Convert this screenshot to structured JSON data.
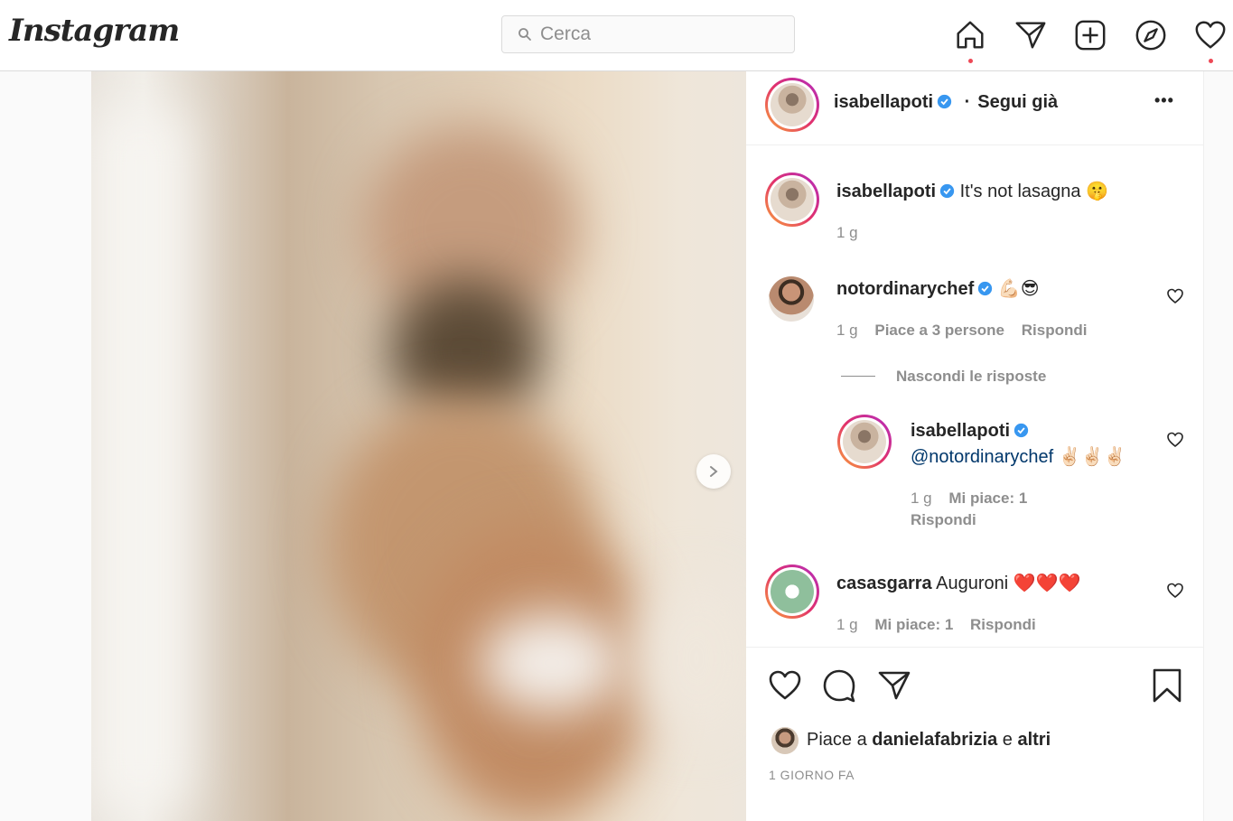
{
  "header": {
    "logo": "Instagram",
    "search_placeholder": "Cerca",
    "nav": [
      "home-icon",
      "direct-icon",
      "new-post-icon",
      "explore-icon",
      "activity-icon"
    ]
  },
  "post": {
    "author": "isabellapoti",
    "follow_status": "Segui già",
    "more": "•••"
  },
  "caption": {
    "user": "isabellapoti",
    "text": "It's not lasagna 🤫",
    "time": "1 g"
  },
  "comments": [
    {
      "user": "notordinarychef",
      "text": "💪🏻😎",
      "time": "1 g",
      "likes": "Piace a 3 persone",
      "reply": "Rispondi",
      "hide_replies": "Nascondi le risposte"
    },
    {
      "user": "isabellapoti",
      "mention": "@notordinarychef",
      "text": "✌🏻✌🏻✌🏻",
      "time": "1 g",
      "likes": "Mi piace: 1",
      "reply": "Rispondi"
    },
    {
      "user": "casasgarra",
      "text": "Auguroni ❤️❤️❤️",
      "time": "1 g",
      "likes": "Mi piace: 1",
      "reply": "Rispondi"
    }
  ],
  "footer": {
    "likes_prefix": "Piace a",
    "liked_by": "danielafabrizia",
    "and": "e",
    "others": "altri",
    "date": "1 GIORNO FA"
  },
  "colors": {
    "verified": "#3897f0",
    "notification_dot": "#ed4956",
    "mention_link": "#00376b"
  }
}
